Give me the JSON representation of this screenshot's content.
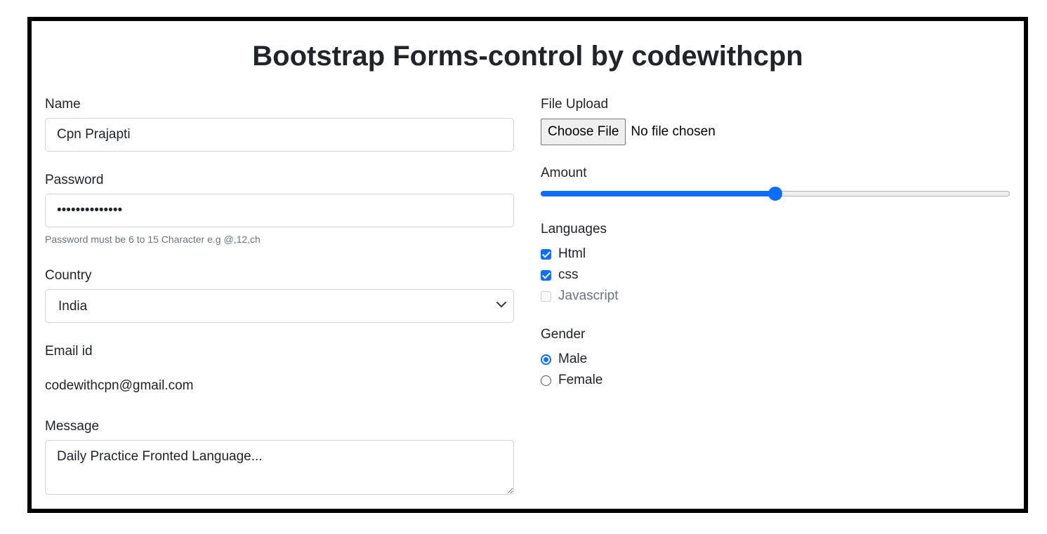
{
  "title": "Bootstrap Forms-control by codewithcpn",
  "form": {
    "name": {
      "label": "Name",
      "value": "Cpn Prajapti"
    },
    "password": {
      "label": "Password",
      "value": "••••••••••••••",
      "help": "Password must be 6 to 15 Character e.g @,12,ch"
    },
    "country": {
      "label": "Country",
      "selected": "India"
    },
    "email": {
      "label": "Email id",
      "value": "codewithcpn@gmail.com"
    },
    "message": {
      "label": "Message",
      "placeholder": "Daily Practice Fronted Language..."
    },
    "file": {
      "label": "File Upload",
      "button": "Choose File",
      "status": "No file chosen"
    },
    "amount": {
      "label": "Amount",
      "level_percent": 50
    },
    "languages": {
      "label": "Languages",
      "items": [
        {
          "label": "Html",
          "checked": true,
          "disabled": false
        },
        {
          "label": "css",
          "checked": true,
          "disabled": false
        },
        {
          "label": "Javascript",
          "checked": false,
          "disabled": true
        }
      ]
    },
    "gender": {
      "label": "Gender",
      "options": [
        {
          "label": "Male",
          "selected": true
        },
        {
          "label": "Female",
          "selected": false
        }
      ]
    }
  },
  "colors": {
    "accent": "#0d6efd",
    "border": "#ced4da",
    "muted": "#6c757d"
  },
  "icons": {
    "select_arrow": "chevron-down-icon"
  }
}
